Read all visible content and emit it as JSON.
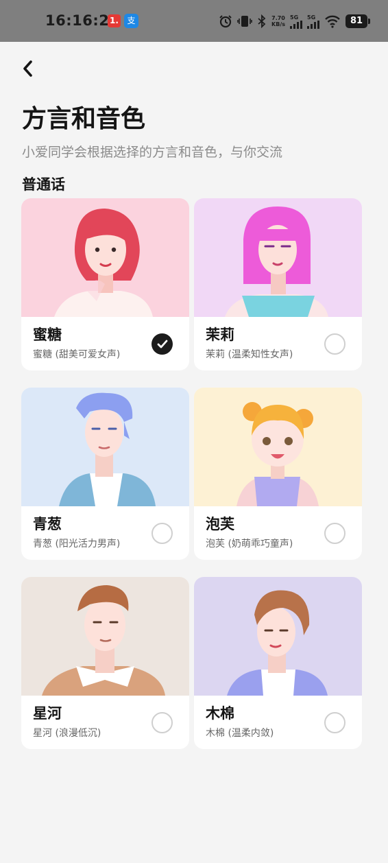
{
  "status_bar": {
    "time": "16:16:20",
    "app_badge_1": "1.",
    "app_badge_2": "支",
    "net_speed_value": "7.70",
    "net_speed_unit": "KB/s",
    "sim1": "5G",
    "sim2": "5G",
    "battery": "81",
    "icons": [
      "alarm-icon",
      "vibrate-icon",
      "bluetooth-icon",
      "signal-icon",
      "wifi-icon",
      "battery-icon"
    ]
  },
  "header": {
    "title": "方言和音色",
    "subtitle": "小爱同学会根据选择的方言和音色，与你交流",
    "back_icon": "chevron-left-icon"
  },
  "section": {
    "title": "普通话"
  },
  "voices": [
    {
      "name": "蜜糖",
      "desc": "蜜糖 (甜美可爱女声)",
      "selected": true,
      "bg": "#fbd3de"
    },
    {
      "name": "茉莉",
      "desc": "茉莉 (温柔知性女声)",
      "selected": false,
      "bg": "#f1d8f6"
    },
    {
      "name": "青葱",
      "desc": "青葱 (阳光活力男声)",
      "selected": false,
      "bg": "#dce8f8"
    },
    {
      "name": "泡芙",
      "desc": "泡芙 (奶萌乖巧童声)",
      "selected": false,
      "bg": "#fdf1d4"
    },
    {
      "name": "星河",
      "desc": "星河 (浪漫低沉)",
      "selected": false,
      "bg": "#ede5df"
    },
    {
      "name": "木棉",
      "desc": "木棉 (温柔内敛)",
      "selected": false,
      "bg": "#dcd6f1"
    }
  ],
  "colors": {
    "accent": "#1c1c1c",
    "radio_border": "#cfcfcf",
    "page_bg": "#f4f4f4"
  }
}
